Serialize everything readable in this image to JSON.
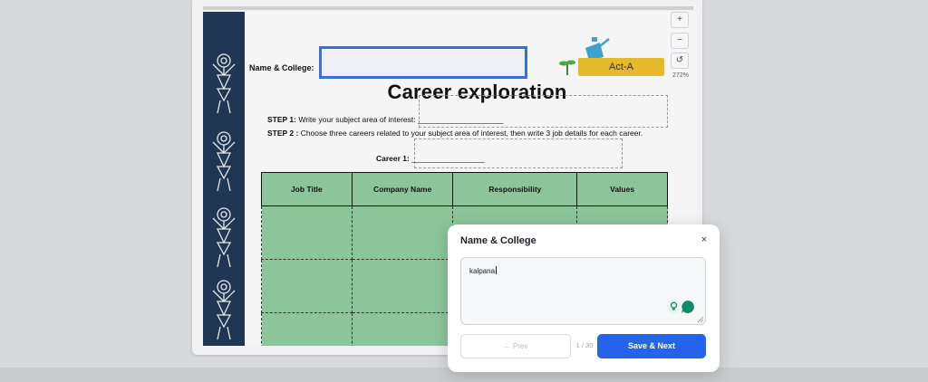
{
  "worksheet": {
    "name_label": "Name & College:",
    "title": "Career exploration",
    "act_badge": "Act-A",
    "step1_label": "STEP 1:",
    "step1_text": " Write your subject area of interest: ____________________",
    "step2_label": "STEP 2 :",
    "step2_text": " Choose three careers related to your subject area of interest, then write 3 job details for each career.",
    "career1_label": "Career 1:",
    "career1_blank": "_________________",
    "table_headers": [
      "Job Title",
      "Company Name",
      "Responsibility",
      "Values"
    ]
  },
  "zoom": {
    "plus": "+",
    "minus": "−",
    "reset": "↺",
    "level": "272%"
  },
  "modal": {
    "title": "Name & College",
    "close": "×",
    "answer_value": "kalpana",
    "prev_label": "← Prev",
    "page_count": "1 / 30",
    "save_label": "Save & Next"
  },
  "colors": {
    "accent": "#2563eb",
    "table_fill": "#8cc59a",
    "strip": "#1f3654",
    "badge": "#e5b92a",
    "chat_icon": "#0f8b6a"
  },
  "icons": [
    "close-icon",
    "lightbulb-icon",
    "chat-icon",
    "watering-can-icon",
    "plant-icon",
    "tribal-figure-icon"
  ]
}
